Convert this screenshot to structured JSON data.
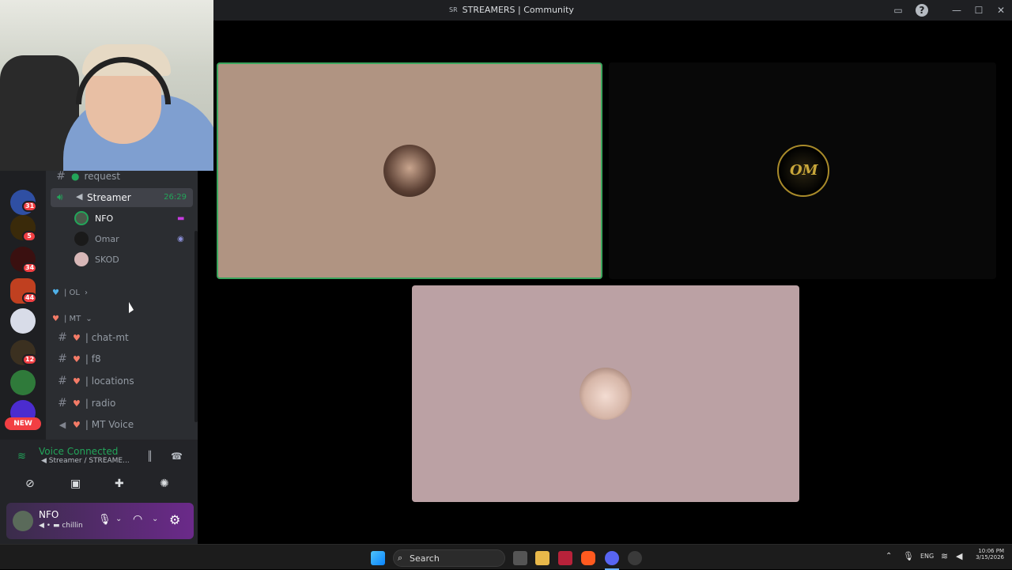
{
  "window": {
    "title": "STREAMERS | Community",
    "server_short": "SR"
  },
  "channels": {
    "items": [
      {
        "type": "text",
        "label": "request",
        "badge": "green"
      },
      {
        "type": "voice",
        "label": "Streamer",
        "timer": "26:29"
      },
      {
        "type": "category",
        "label": "| OL"
      },
      {
        "type": "category",
        "label": "| MT"
      },
      {
        "type": "text",
        "label": "| chat-mt"
      },
      {
        "type": "text",
        "label": "| f8"
      },
      {
        "type": "text",
        "label": "| locations"
      },
      {
        "type": "text",
        "label": "| radio"
      },
      {
        "type": "voice",
        "label": "| MT Voice"
      }
    ],
    "voice_users": [
      "NFO",
      "Omar",
      "SKOD"
    ]
  },
  "servers": {
    "badges": [
      "31",
      "5",
      "34",
      "44",
      "12"
    ],
    "new_label": "NEW"
  },
  "voice_panel": {
    "status": "Voice Connected",
    "location": "Streamer / STREAME..."
  },
  "user": {
    "name": "NFO",
    "status": "chillin"
  },
  "taskbar": {
    "search_placeholder": "Search",
    "lang": "ENG",
    "time": "10:06 PM",
    "date": "3/15/2026"
  },
  "colors": {
    "accent": "#23a55a",
    "brand": "#5865f2",
    "badge": "#f23f43"
  }
}
